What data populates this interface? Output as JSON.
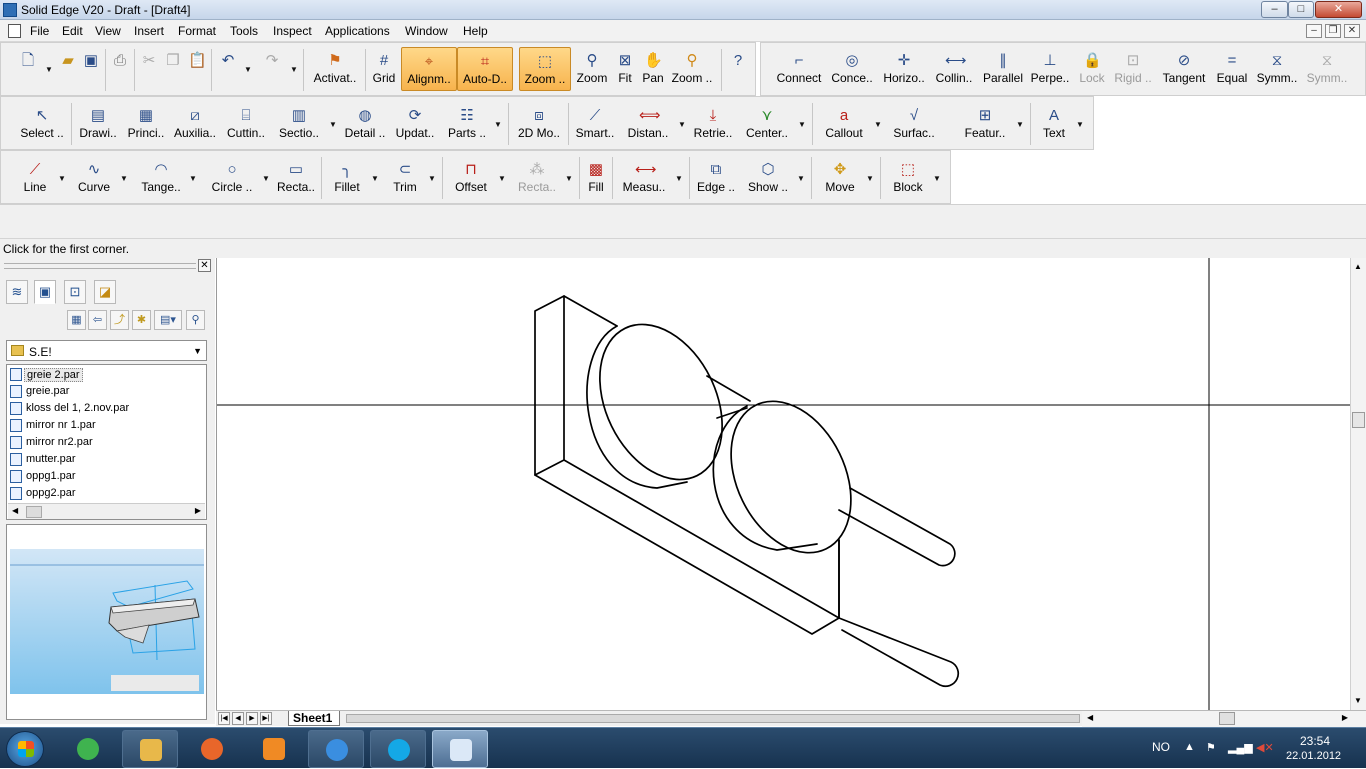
{
  "window": {
    "title": "Solid Edge V20 - Draft - [Draft4]",
    "controls": {
      "minimize": "–",
      "maximize": "□",
      "close": "✕"
    }
  },
  "menu": {
    "items": [
      "File",
      "Edit",
      "View",
      "Insert",
      "Format",
      "Tools",
      "Inspect",
      "Applications",
      "Window",
      "Help"
    ],
    "mdi": {
      "minimize": "–",
      "restore": "❐",
      "close": "✕"
    }
  },
  "toolbar1": {
    "activate": "Activat..",
    "grid": "Grid",
    "alignment": "Alignm..",
    "auto_dimension": "Auto-D..",
    "zoom_area": "Zoom ..",
    "zoom": "Zoom",
    "fit": "Fit",
    "pan": "Pan",
    "zoom_tool": "Zoom ..",
    "help_pointer": "?"
  },
  "relations": {
    "connect": "Connect",
    "concentric": "Conce..",
    "horizontal": "Horizo..",
    "collinear": "Collin..",
    "parallel": "Parallel",
    "perpendicular": "Perpe..",
    "lock": "Lock",
    "rigid": "Rigid ..",
    "tangent": "Tangent",
    "equal": "Equal",
    "symmetric": "Symm..",
    "symmetric2": "Symm.."
  },
  "toolbar2": {
    "select": "Select ..",
    "drawing_view": "Drawi..",
    "principal": "Princi..",
    "auxiliary": "Auxilia..",
    "cutting": "Cuttin..",
    "section": "Sectio..",
    "detail": "Detail ..",
    "update": "Updat..",
    "parts": "Parts ..",
    "model_2d": "2D Mo..",
    "smart": "Smart..",
    "distance": "Distan..",
    "retrieve": "Retrie..",
    "center": "Center..",
    "callout": "Callout",
    "surface": "Surfac..",
    "feature": "Featur..",
    "text": "Text"
  },
  "toolbar3": {
    "line": "Line",
    "curve": "Curve",
    "tangent_arc": "Tange..",
    "circle": "Circle ..",
    "rectangle": "Recta..",
    "fillet": "Fillet",
    "trim": "Trim",
    "offset": "Offset",
    "rectangle2": "Recta..",
    "fill": "Fill",
    "measure": "Measu..",
    "edge": "Edge ..",
    "show": "Show ..",
    "move": "Move",
    "block": "Block"
  },
  "prompt": "Click for the first corner.",
  "library": {
    "folder": "S.E!",
    "files": [
      "greie 2.par",
      "greie.par",
      "kloss del 1, 2.nov.par",
      "mirror nr 1.par",
      "mirror nr2.par",
      "mutter.par",
      "oppg1.par",
      "oppg2.par"
    ],
    "selected_index": 0
  },
  "sheet": {
    "tab": "Sheet1"
  },
  "taskbar": {
    "apps": [
      {
        "name": "spotify",
        "color": "#3fb34f"
      },
      {
        "name": "explorer",
        "color": "#e8b84a"
      },
      {
        "name": "firefox",
        "color": "#e8662a"
      },
      {
        "name": "media-player",
        "color": "#f08a24"
      },
      {
        "name": "internet-explorer",
        "color": "#3a8ee0"
      },
      {
        "name": "skype",
        "color": "#14a8e6"
      },
      {
        "name": "solid-edge",
        "color": "#dbe8f7"
      }
    ],
    "language": "NO",
    "time": "23:54",
    "date": "22.01.2012"
  }
}
